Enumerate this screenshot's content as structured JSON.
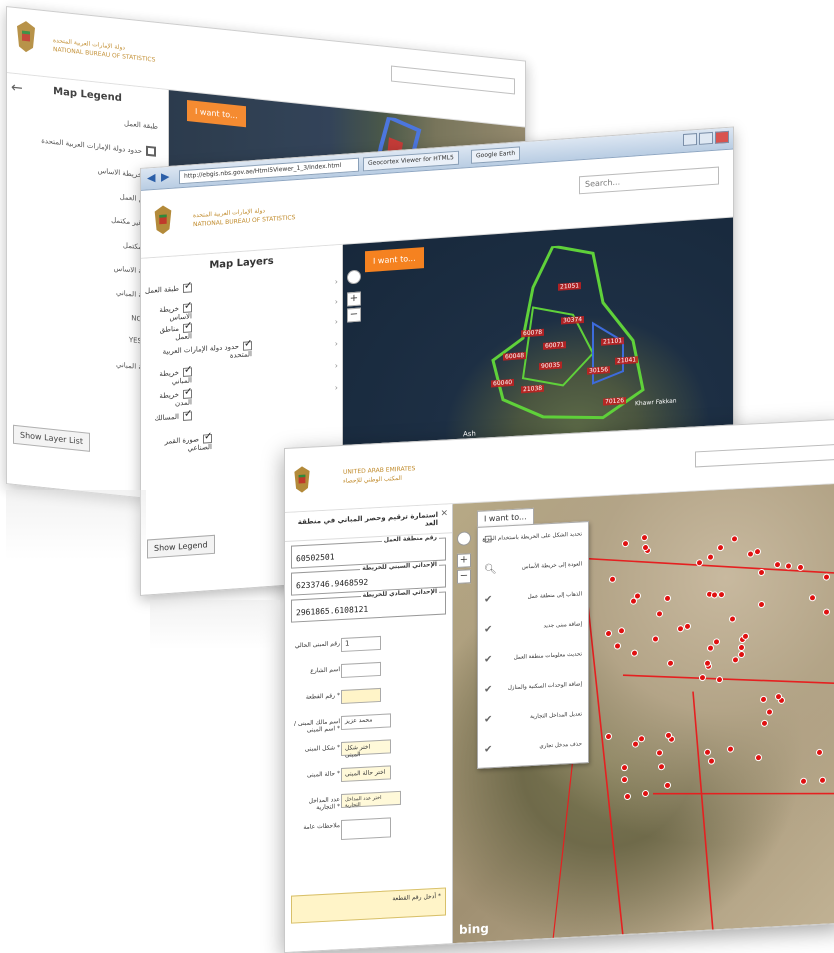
{
  "org": {
    "line1_ar": "دولة الإمارات العربية المتحدة",
    "line1_en": "UNITED ARAB EMIRATES",
    "line2_en": "NATIONAL BUREAU OF STATISTICS",
    "line2_ar": "المكتب الوطني للإحصاء"
  },
  "window1": {
    "panel_title": "Map Legend",
    "back_icon": "arrow-left-icon",
    "legend": [
      {
        "label": "طبقة العمل",
        "swatch": ""
      },
      {
        "label": "حدود دولة الإمارات العربية المتحدة",
        "swatch": "#555555"
      },
      {
        "label": "خريطة الاساس",
        "swatch": "#4aa0d8"
      },
      {
        "label": "مناطق العمل",
        "swatch": ""
      },
      {
        "label": "غير مكتمل",
        "swatch": "#d04040"
      },
      {
        "label": "مكتمل",
        "swatch": "#8ed04a"
      },
      {
        "label": "خريطة الاساس",
        "swatch": ""
      },
      {
        "label": "خريطة المباني",
        "swatch": ""
      },
      {
        "label": "NO",
        "swatch": "#e01010"
      },
      {
        "label": "YES",
        "swatch": "#30d030"
      },
      {
        "label": "خريطة المباني",
        "swatch": ""
      }
    ],
    "show_button": "Show Layer List",
    "iwant": "I want to..."
  },
  "window2": {
    "address": "http://ebgis.nbs.gov.ae/Html5Viewer_1_3/Index.html",
    "tabs": [
      "Geocortex Viewer for HTML5",
      "Google Earth"
    ],
    "search_placeholder": "Search...",
    "panel_title": "Map Layers",
    "layers": [
      "طبقة العمل",
      "خريطة الاساس",
      "مناطق العمل",
      "حدود دولة الإمارات العربية المتحدة",
      "خريطة المباني",
      "خريطة المدن",
      "المسالك",
      "صورة القمر الصناعي"
    ],
    "show_button": "Show Legend",
    "iwant": "I want to...",
    "map_labels": [
      "21051",
      "60078",
      "30374",
      "60071",
      "60048",
      "90035",
      "21101",
      "60040",
      "21038",
      "30156",
      "21041",
      "70126"
    ],
    "place_labels": [
      "Ash",
      "Khawr Fakkan"
    ]
  },
  "window3": {
    "form_title": "استمارة ترقيم وحصر المباني في منطقة العد",
    "fields": [
      {
        "legend": "رقم منطقة العمل",
        "value": "60502501"
      },
      {
        "legend": "الإحداثي السيني للخريطة",
        "value": "6233746.9468592"
      },
      {
        "legend": "الإحداثي الصادي للخريطة",
        "value": "2961865.6108121"
      }
    ],
    "rows": [
      {
        "label": "رقم المبنى الحالي",
        "value": "1",
        "kind": "input"
      },
      {
        "label": "اسم الشارع",
        "value": "",
        "kind": "input"
      },
      {
        "label": "رقم القطعة *",
        "value": "",
        "kind": "req"
      },
      {
        "label": "اسم مالك المبنى / اسم المبنى *",
        "value": "محمد عزيز",
        "kind": "input"
      },
      {
        "label": "شكل المبنى *",
        "value": "اختر شكل المبنى",
        "kind": "select"
      },
      {
        "label": "حالة المبنى *",
        "value": "اختر حالة المبنى",
        "kind": "select"
      },
      {
        "label": "عدد المداخل التجارية *",
        "value": "اختر عدد المداخل التجارية",
        "kind": "select"
      },
      {
        "label": "ملاحظات عامة",
        "value": "",
        "kind": "input"
      }
    ],
    "note": "أدخل رقم القطعة *",
    "iwant": "I want to...",
    "menu": [
      {
        "label": "تحديد الشكل على الخريطة باستخدام المربع",
        "icon": "select-icon"
      },
      {
        "label": "العودة إلى خريطة الأساس",
        "icon": "zoom-icon"
      },
      {
        "label": "الذهاب إلى منطقة عمل",
        "icon": "check-icon"
      },
      {
        "label": "إضافة مبنى جديد",
        "icon": "check-icon"
      },
      {
        "label": "تحديث معلومات منطقة العمل",
        "icon": "check-icon"
      },
      {
        "label": "إضافة الوحدات السكنية والمنازل",
        "icon": "check-icon"
      },
      {
        "label": "تعديل المداخل التجارية",
        "icon": "check-icon"
      },
      {
        "label": "حذف مدخل تجاري",
        "icon": "check-icon"
      }
    ],
    "map_attribution": "bing"
  }
}
